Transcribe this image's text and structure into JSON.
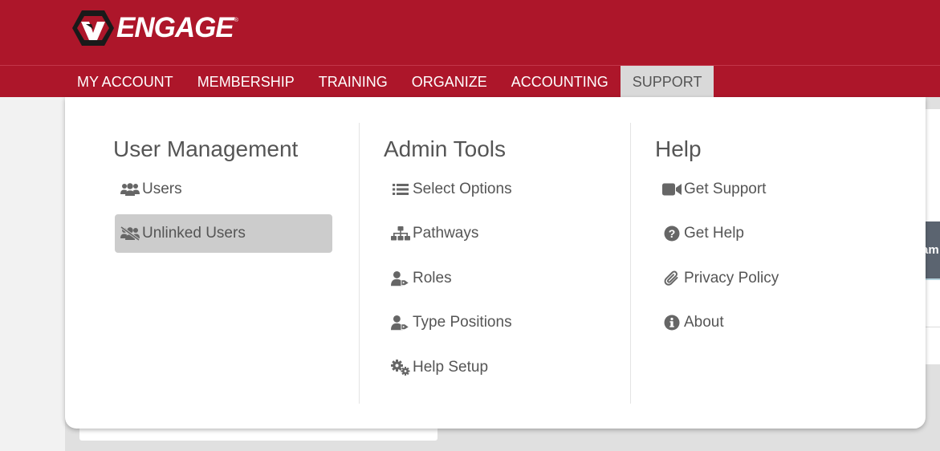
{
  "brand": {
    "logo_text": "ENGAGE",
    "trademark": "®",
    "header_color": "#ad162a"
  },
  "nav": {
    "items": [
      {
        "label": "MY ACCOUNT",
        "active": false
      },
      {
        "label": "MEMBERSHIP",
        "active": false
      },
      {
        "label": "TRAINING",
        "active": false
      },
      {
        "label": "ORGANIZE",
        "active": false
      },
      {
        "label": "ACCOUNTING",
        "active": false
      },
      {
        "label": "SUPPORT",
        "active": true
      }
    ]
  },
  "background": {
    "right_button_fragment": "am"
  },
  "dropdown": {
    "columns": [
      {
        "title": "User Management",
        "items": [
          {
            "label": "Users",
            "icon": "users-icon",
            "selected": false
          },
          {
            "label": "Unlinked Users",
            "icon": "users-slash-icon",
            "selected": true
          }
        ]
      },
      {
        "title": "Admin Tools",
        "items": [
          {
            "label": "Select Options",
            "icon": "list-icon",
            "selected": false
          },
          {
            "label": "Pathways",
            "icon": "sitemap-icon",
            "selected": false
          },
          {
            "label": "Roles",
            "icon": "user-tag-icon",
            "selected": false
          },
          {
            "label": "Type Positions",
            "icon": "user-tag-icon",
            "selected": false
          },
          {
            "label": "Help Setup",
            "icon": "cogs-icon",
            "selected": false
          }
        ]
      },
      {
        "title": "Help",
        "items": [
          {
            "label": "Get Support",
            "icon": "video-icon",
            "selected": false
          },
          {
            "label": "Get Help",
            "icon": "question-circle-icon",
            "selected": false
          },
          {
            "label": "Privacy Policy",
            "icon": "paperclip-icon",
            "selected": false
          },
          {
            "label": "About",
            "icon": "info-circle-icon",
            "selected": false
          }
        ]
      }
    ]
  }
}
